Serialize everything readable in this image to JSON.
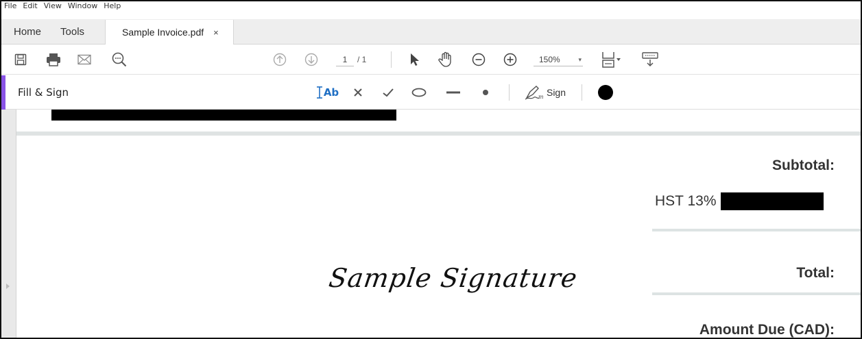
{
  "menu": [
    "File",
    "Edit",
    "View",
    "Window",
    "Help"
  ],
  "tabs": {
    "home": "Home",
    "tools": "Tools",
    "document": "Sample Invoice.pdf",
    "close": "×"
  },
  "toolbar": {
    "page_current": "1",
    "page_total": "/ 1",
    "zoom": "150%",
    "zoom_caret": "▾"
  },
  "fill_sign": {
    "title": "Fill & Sign",
    "text_tool": "Ab",
    "sign_label": "Sign",
    "color": "#000000"
  },
  "document": {
    "subtotal_label": "Subtotal:",
    "hst_label": "HST 13%",
    "total_label": "Total:",
    "amount_due_label": "Amount Due (CAD):",
    "signature": "Sample Signature"
  },
  "colors": {
    "accent": "#8a54e6",
    "tool_blue": "#1f6fc4"
  }
}
